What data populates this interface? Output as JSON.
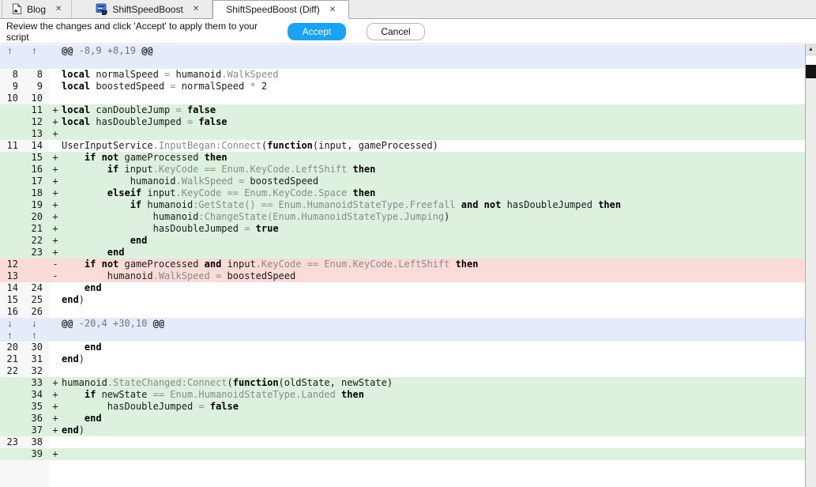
{
  "tabs": [
    {
      "label": "Blog",
      "icon": "page-icon",
      "active": false
    },
    {
      "label": "ShiftSpeedBoost",
      "icon": "script-icon",
      "active": false
    },
    {
      "label": "ShiftSpeedBoost (Diff)",
      "icon": null,
      "active": true
    }
  ],
  "icons": {
    "close": "✕",
    "scroll_up": "▲"
  },
  "toolbar": {
    "message": "Review the changes and click 'Accept' to apply them to your script",
    "accept_label": "Accept",
    "cancel_label": "Cancel"
  },
  "colors": {
    "accept_blue": "#1aa3f5",
    "added_bg": "#def1df",
    "removed_bg": "#fbdbd8",
    "hunk_bg": "#e4ecf9",
    "gutter_bg": "#f7f7f7",
    "keyword": "#000000",
    "member_gray": "#8a8a8a"
  },
  "diff": {
    "hunk_headers": [
      "@@ -8,9 +8,19 @@",
      "@@ -20,4 +30,10 @@"
    ],
    "rows": [
      {
        "type": "hunk",
        "oldArrow": "↑",
        "newArrow": "↑",
        "segments": [
          {
            "s": "at",
            "t": "@@"
          },
          {
            "s": "hn",
            "t": " -8,9 +8,19 "
          },
          {
            "s": "at",
            "t": "@@"
          }
        ]
      },
      {
        "type": "hunk",
        "segments": []
      },
      {
        "type": "context",
        "old": "8",
        "new": "8",
        "segments": [
          {
            "s": "k",
            "t": "local"
          },
          {
            "s": "p",
            "t": " normalSpeed "
          },
          {
            "s": "m",
            "t": "= "
          },
          {
            "s": "p",
            "t": "humanoid"
          },
          {
            "s": "m",
            "t": ".WalkSpeed"
          }
        ]
      },
      {
        "type": "context",
        "old": "9",
        "new": "9",
        "segments": [
          {
            "s": "k",
            "t": "local"
          },
          {
            "s": "p",
            "t": " boostedSpeed "
          },
          {
            "s": "m",
            "t": "= "
          },
          {
            "s": "p",
            "t": "normalSpeed "
          },
          {
            "s": "m",
            "t": "* "
          },
          {
            "s": "p",
            "t": "2"
          }
        ]
      },
      {
        "type": "context",
        "old": "10",
        "new": "10",
        "segments": []
      },
      {
        "type": "added",
        "new": "11",
        "marker": "+",
        "segments": [
          {
            "s": "k",
            "t": "local"
          },
          {
            "s": "p",
            "t": " canDoubleJump "
          },
          {
            "s": "m",
            "t": "= "
          },
          {
            "s": "k",
            "t": "false"
          }
        ]
      },
      {
        "type": "added",
        "new": "12",
        "marker": "+",
        "segments": [
          {
            "s": "k",
            "t": "local"
          },
          {
            "s": "p",
            "t": " hasDoubleJumped "
          },
          {
            "s": "m",
            "t": "= "
          },
          {
            "s": "k",
            "t": "false"
          }
        ]
      },
      {
        "type": "added",
        "new": "13",
        "marker": "+",
        "segments": []
      },
      {
        "type": "context",
        "old": "11",
        "new": "14",
        "segments": [
          {
            "s": "p",
            "t": "UserInputService"
          },
          {
            "s": "m",
            "t": ".InputBegan:Connect"
          },
          {
            "s": "p",
            "t": "("
          },
          {
            "s": "k",
            "t": "function"
          },
          {
            "s": "p",
            "t": "(input, gameProcessed)"
          }
        ]
      },
      {
        "type": "added",
        "new": "15",
        "marker": "+",
        "segments": [
          {
            "s": "p",
            "t": "    "
          },
          {
            "s": "k",
            "t": "if"
          },
          {
            "s": "p",
            "t": " "
          },
          {
            "s": "k",
            "t": "not"
          },
          {
            "s": "p",
            "t": " gameProcessed "
          },
          {
            "s": "k",
            "t": "then"
          }
        ]
      },
      {
        "type": "added",
        "new": "16",
        "marker": "+",
        "segments": [
          {
            "s": "p",
            "t": "        "
          },
          {
            "s": "k",
            "t": "if"
          },
          {
            "s": "p",
            "t": " input"
          },
          {
            "s": "m",
            "t": ".KeyCode == Enum.KeyCode.LeftShift "
          },
          {
            "s": "k",
            "t": "then"
          }
        ]
      },
      {
        "type": "added",
        "new": "17",
        "marker": "+",
        "segments": [
          {
            "s": "p",
            "t": "            humanoid"
          },
          {
            "s": "m",
            "t": ".WalkSpeed = "
          },
          {
            "s": "p",
            "t": "boostedSpeed"
          }
        ]
      },
      {
        "type": "added",
        "new": "18",
        "marker": "+",
        "segments": [
          {
            "s": "p",
            "t": "        "
          },
          {
            "s": "k",
            "t": "elseif"
          },
          {
            "s": "p",
            "t": " input"
          },
          {
            "s": "m",
            "t": ".KeyCode == Enum.KeyCode.Space "
          },
          {
            "s": "k",
            "t": "then"
          }
        ]
      },
      {
        "type": "added",
        "new": "19",
        "marker": "+",
        "segments": [
          {
            "s": "p",
            "t": "            "
          },
          {
            "s": "k",
            "t": "if"
          },
          {
            "s": "p",
            "t": " humanoid"
          },
          {
            "s": "m",
            "t": ":GetState() == Enum.HumanoidStateType.Freefall "
          },
          {
            "s": "k",
            "t": "and"
          },
          {
            "s": "p",
            "t": " "
          },
          {
            "s": "k",
            "t": "not"
          },
          {
            "s": "p",
            "t": " hasDoubleJumped "
          },
          {
            "s": "k",
            "t": "then"
          }
        ]
      },
      {
        "type": "added",
        "new": "20",
        "marker": "+",
        "segments": [
          {
            "s": "p",
            "t": "                humanoid"
          },
          {
            "s": "m",
            "t": ":ChangeState(Enum.HumanoidStateType.Jumping"
          },
          {
            "s": "p",
            "t": ")"
          }
        ]
      },
      {
        "type": "added",
        "new": "21",
        "marker": "+",
        "segments": [
          {
            "s": "p",
            "t": "                hasDoubleJumped "
          },
          {
            "s": "m",
            "t": "= "
          },
          {
            "s": "k",
            "t": "true"
          }
        ]
      },
      {
        "type": "added",
        "new": "22",
        "marker": "+",
        "segments": [
          {
            "s": "p",
            "t": "            "
          },
          {
            "s": "k",
            "t": "end"
          }
        ]
      },
      {
        "type": "added",
        "new": "23",
        "marker": "+",
        "segments": [
          {
            "s": "p",
            "t": "        "
          },
          {
            "s": "k",
            "t": "end"
          }
        ]
      },
      {
        "type": "removed",
        "old": "12",
        "marker": "-",
        "segments": [
          {
            "s": "p",
            "t": "    "
          },
          {
            "s": "k",
            "t": "if"
          },
          {
            "s": "p",
            "t": " "
          },
          {
            "s": "k",
            "t": "not"
          },
          {
            "s": "p",
            "t": " gameProcessed "
          },
          {
            "s": "k",
            "t": "and"
          },
          {
            "s": "p",
            "t": " input"
          },
          {
            "s": "m",
            "t": ".KeyCode == Enum.KeyCode.LeftShift "
          },
          {
            "s": "k",
            "t": "then"
          }
        ]
      },
      {
        "type": "removed",
        "old": "13",
        "marker": "-",
        "segments": [
          {
            "s": "p",
            "t": "        humanoid"
          },
          {
            "s": "m",
            "t": ".WalkSpeed = "
          },
          {
            "s": "p",
            "t": "boostedSpeed"
          }
        ]
      },
      {
        "type": "context",
        "old": "14",
        "new": "24",
        "segments": [
          {
            "s": "p",
            "t": "    "
          },
          {
            "s": "k",
            "t": "end"
          }
        ]
      },
      {
        "type": "context",
        "old": "15",
        "new": "25",
        "segments": [
          {
            "s": "k",
            "t": "end"
          },
          {
            "s": "p",
            "t": ")"
          }
        ]
      },
      {
        "type": "context",
        "old": "16",
        "new": "26",
        "segments": []
      },
      {
        "type": "hunk",
        "oldArrow": "↓",
        "newArrow": "↓",
        "segments": [
          {
            "s": "at",
            "t": "@@"
          },
          {
            "s": "hn",
            "t": " -20,4 +30,10 "
          },
          {
            "s": "at",
            "t": "@@"
          }
        ]
      },
      {
        "type": "hunk",
        "oldArrow": "↑",
        "newArrow": "↑",
        "segments": []
      },
      {
        "type": "context",
        "old": "20",
        "new": "30",
        "segments": [
          {
            "s": "p",
            "t": "    "
          },
          {
            "s": "k",
            "t": "end"
          }
        ]
      },
      {
        "type": "context",
        "old": "21",
        "new": "31",
        "segments": [
          {
            "s": "k",
            "t": "end"
          },
          {
            "s": "p",
            "t": ")"
          }
        ]
      },
      {
        "type": "context",
        "old": "22",
        "new": "32",
        "segments": []
      },
      {
        "type": "added",
        "new": "33",
        "marker": "+",
        "segments": [
          {
            "s": "p",
            "t": "humanoid"
          },
          {
            "s": "m",
            "t": ".StateChanged:Connect"
          },
          {
            "s": "p",
            "t": "("
          },
          {
            "s": "k",
            "t": "function"
          },
          {
            "s": "p",
            "t": "(oldState, newState)"
          }
        ]
      },
      {
        "type": "added",
        "new": "34",
        "marker": "+",
        "segments": [
          {
            "s": "p",
            "t": "    "
          },
          {
            "s": "k",
            "t": "if"
          },
          {
            "s": "p",
            "t": " newState "
          },
          {
            "s": "m",
            "t": "== Enum.HumanoidStateType.Landed "
          },
          {
            "s": "k",
            "t": "then"
          }
        ]
      },
      {
        "type": "added",
        "new": "35",
        "marker": "+",
        "segments": [
          {
            "s": "p",
            "t": "        hasDoubleJumped "
          },
          {
            "s": "m",
            "t": "= "
          },
          {
            "s": "k",
            "t": "false"
          }
        ]
      },
      {
        "type": "added",
        "new": "36",
        "marker": "+",
        "segments": [
          {
            "s": "p",
            "t": "    "
          },
          {
            "s": "k",
            "t": "end"
          }
        ]
      },
      {
        "type": "added",
        "new": "37",
        "marker": "+",
        "segments": [
          {
            "s": "k",
            "t": "end"
          },
          {
            "s": "p",
            "t": ")"
          }
        ]
      },
      {
        "type": "context",
        "old": "23",
        "new": "38",
        "segments": []
      },
      {
        "type": "added",
        "new": "39",
        "marker": "+",
        "segments": []
      }
    ]
  }
}
